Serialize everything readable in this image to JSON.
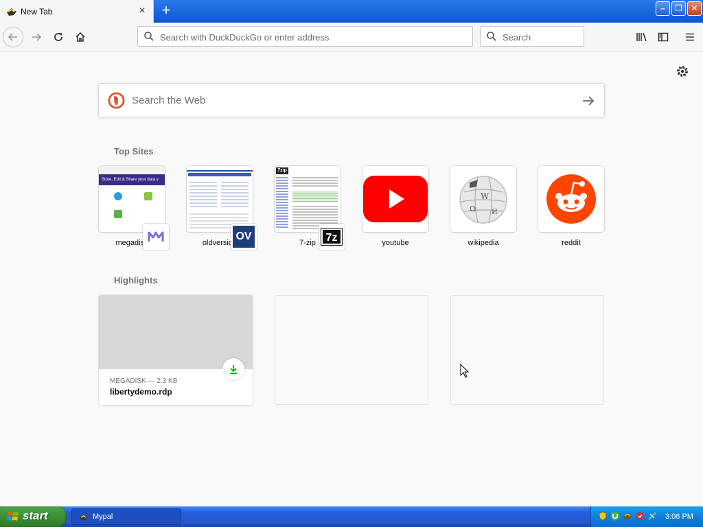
{
  "browser": {
    "tab_title": "New Tab",
    "close_tab_glyph": "×",
    "new_tab_glyph": "+",
    "url_placeholder": "Search with DuckDuckGo or enter address",
    "search_placeholder": "Search"
  },
  "window_controls": {
    "minimize": "–",
    "restore": "❐",
    "close": "✕"
  },
  "page": {
    "web_search_placeholder": "Search the Web",
    "top_sites_title": "Top Sites",
    "highlights_title": "Highlights",
    "top_sites": [
      {
        "label": "megadisk"
      },
      {
        "label": "oldversion"
      },
      {
        "label": "7-zip"
      },
      {
        "label": "youtube"
      },
      {
        "label": "wikipedia"
      },
      {
        "label": "reddit"
      }
    ],
    "highlight": {
      "meta": "MEGADISK — 2.3 KB",
      "filename": "libertydemo.rdp"
    },
    "thumbs": {
      "megadisk_banner": "Store, Edit & Share your data v",
      "oldversion_badge": "OV",
      "sevenzip_badge": "7z",
      "sevenzip_logo": "7zip"
    }
  },
  "taskbar": {
    "start_label": "start",
    "task_item": "Mypal",
    "clock": "3:06 PM"
  },
  "colors": {
    "accent_blue": "#0a84ff",
    "youtube_red": "#ff0000",
    "reddit_orange": "#ff4500",
    "download_green": "#12bc00"
  }
}
